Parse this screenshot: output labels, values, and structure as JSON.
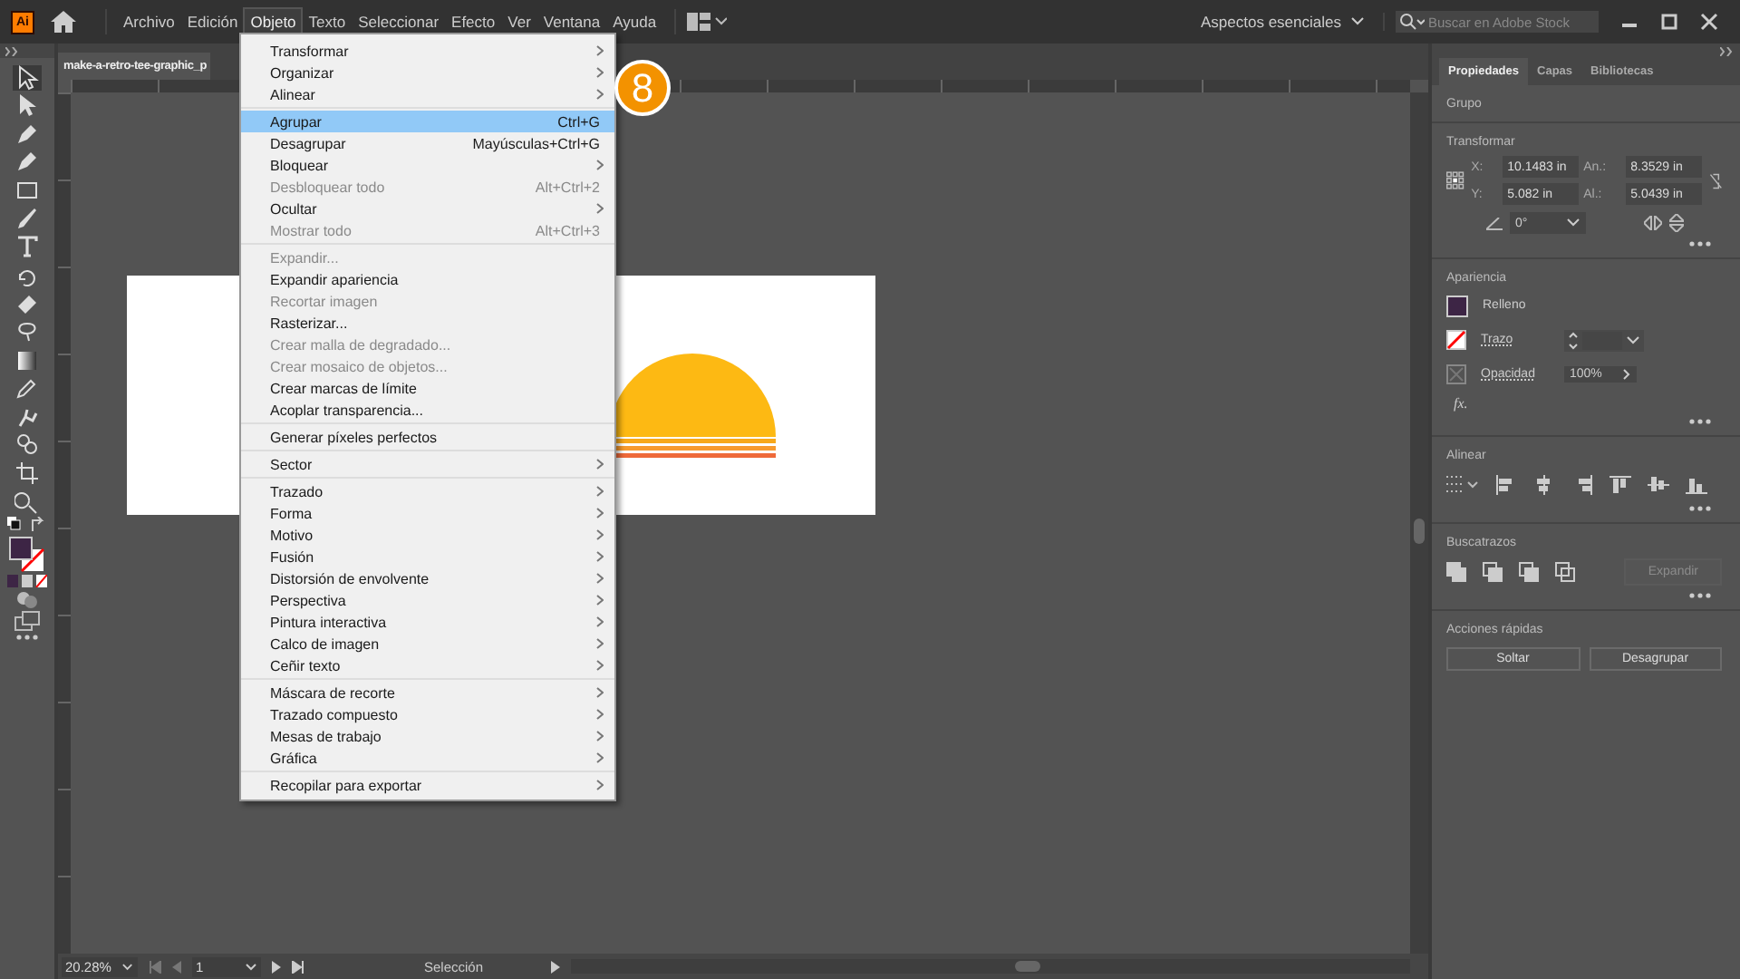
{
  "app_logo": "Ai",
  "menubar": [
    {
      "label": "Archivo",
      "selected": false
    },
    {
      "label": "Edición",
      "selected": false
    },
    {
      "label": "Objeto",
      "selected": true
    },
    {
      "label": "Texto",
      "selected": false
    },
    {
      "label": "Seleccionar",
      "selected": false
    },
    {
      "label": "Efecto",
      "selected": false
    },
    {
      "label": "Ver",
      "selected": false
    },
    {
      "label": "Ventana",
      "selected": false
    },
    {
      "label": "Ayuda",
      "selected": false
    }
  ],
  "workspace": "Aspectos esenciales",
  "search": {
    "placeholder": "Buscar en Adobe Stock"
  },
  "document_tab": "make-a-retro-tee-graphic_p",
  "menu": [
    [
      {
        "label": "Transformar",
        "submenu": true,
        "disabled": false,
        "selected": false
      },
      {
        "label": "Organizar",
        "submenu": true,
        "disabled": false,
        "selected": false
      },
      {
        "label": "Alinear",
        "submenu": true,
        "disabled": false,
        "selected": false
      }
    ],
    [
      {
        "label": "Agrupar",
        "shortcut": "Ctrl+G",
        "submenu": false,
        "disabled": false,
        "selected": true
      },
      {
        "label": "Desagrupar",
        "shortcut": "Mayúsculas+Ctrl+G",
        "submenu": false,
        "disabled": false,
        "selected": false
      },
      {
        "label": "Bloquear",
        "submenu": true,
        "disabled": false,
        "selected": false
      },
      {
        "label": "Desbloquear todo",
        "shortcut": "Alt+Ctrl+2",
        "submenu": false,
        "disabled": true,
        "selected": false
      },
      {
        "label": "Ocultar",
        "submenu": true,
        "disabled": false,
        "selected": false
      },
      {
        "label": "Mostrar todo",
        "shortcut": "Alt+Ctrl+3",
        "submenu": false,
        "disabled": true,
        "selected": false
      }
    ],
    [
      {
        "label": "Expandir...",
        "submenu": false,
        "disabled": true,
        "selected": false
      },
      {
        "label": "Expandir apariencia",
        "submenu": false,
        "disabled": false,
        "selected": false
      },
      {
        "label": "Recortar imagen",
        "submenu": false,
        "disabled": true,
        "selected": false
      },
      {
        "label": "Rasterizar...",
        "submenu": false,
        "disabled": false,
        "selected": false
      },
      {
        "label": "Crear malla de degradado...",
        "submenu": false,
        "disabled": true,
        "selected": false
      },
      {
        "label": "Crear mosaico de objetos...",
        "submenu": false,
        "disabled": true,
        "selected": false
      },
      {
        "label": "Crear marcas de límite",
        "submenu": false,
        "disabled": false,
        "selected": false
      },
      {
        "label": "Acoplar transparencia...",
        "submenu": false,
        "disabled": false,
        "selected": false
      }
    ],
    [
      {
        "label": "Generar píxeles perfectos",
        "submenu": false,
        "disabled": false,
        "selected": false
      }
    ],
    [
      {
        "label": "Sector",
        "submenu": true,
        "disabled": false,
        "selected": false
      }
    ],
    [
      {
        "label": "Trazado",
        "submenu": true,
        "disabled": false,
        "selected": false
      },
      {
        "label": "Forma",
        "submenu": true,
        "disabled": false,
        "selected": false
      },
      {
        "label": "Motivo",
        "submenu": true,
        "disabled": false,
        "selected": false
      },
      {
        "label": "Fusión",
        "submenu": true,
        "disabled": false,
        "selected": false
      },
      {
        "label": "Distorsión de envolvente",
        "submenu": true,
        "disabled": false,
        "selected": false
      },
      {
        "label": "Perspectiva",
        "submenu": true,
        "disabled": false,
        "selected": false
      },
      {
        "label": "Pintura interactiva",
        "submenu": true,
        "disabled": false,
        "selected": false
      },
      {
        "label": "Calco de imagen",
        "submenu": true,
        "disabled": false,
        "selected": false
      },
      {
        "label": "Ceñir texto",
        "submenu": true,
        "disabled": false,
        "selected": false
      }
    ],
    [
      {
        "label": "Máscara de recorte",
        "submenu": true,
        "disabled": false,
        "selected": false
      },
      {
        "label": "Trazado compuesto",
        "submenu": true,
        "disabled": false,
        "selected": false
      },
      {
        "label": "Mesas de trabajo",
        "submenu": true,
        "disabled": false,
        "selected": false
      },
      {
        "label": "Gráfica",
        "submenu": true,
        "disabled": false,
        "selected": false
      }
    ],
    [
      {
        "label": "Recopilar para exportar",
        "submenu": true,
        "disabled": false,
        "selected": false
      }
    ]
  ],
  "step_badge": "8",
  "panel": {
    "tabs": [
      {
        "label": "Propiedades",
        "selected": true
      },
      {
        "label": "Capas",
        "selected": false
      },
      {
        "label": "Bibliotecas",
        "selected": false
      }
    ],
    "selection_type": "Grupo",
    "transform": {
      "title": "Transformar",
      "x_label": "X:",
      "x": "10.1483 in",
      "w_label": "An.:",
      "w": "8.3529 in",
      "y_label": "Y:",
      "y": "5.082 in",
      "h_label": "Al.:",
      "h": "5.0439 in",
      "angle": "0°"
    },
    "appearance": {
      "title": "Apariencia",
      "fill": {
        "label": "Relleno",
        "color": "#3d2545"
      },
      "stroke_label": "Trazo",
      "opacity_label": "Opacidad",
      "opacity": "100%",
      "fx": "fx."
    },
    "align_title": "Alinear",
    "pathfinder": {
      "title": "Buscatrazos",
      "expand": "Expandir",
      "expand_disabled": true
    },
    "quick_actions": {
      "title": "Acciones rápidas",
      "buttons": [
        "Soltar",
        "Desagrupar"
      ]
    }
  },
  "status": {
    "zoom": "20.28%",
    "artboard": "1",
    "tool": "Selección"
  }
}
